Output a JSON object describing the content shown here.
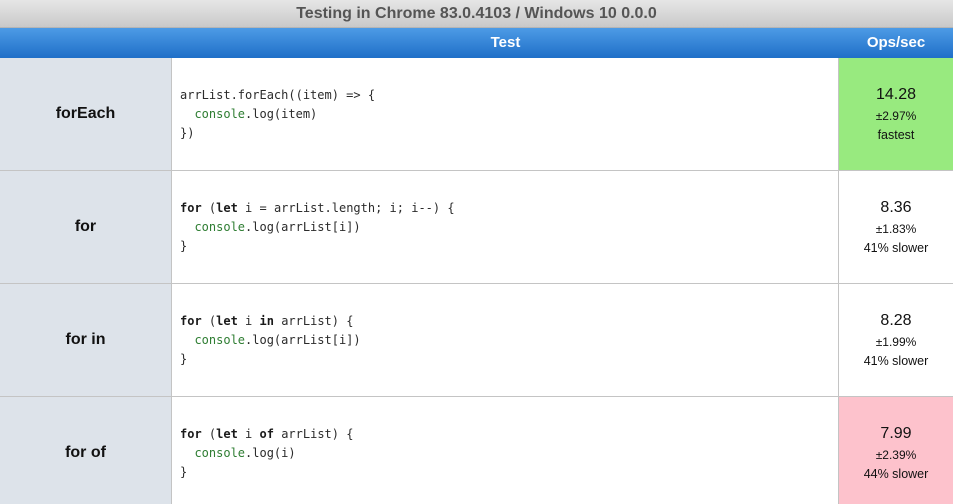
{
  "caption": "Testing in Chrome 83.0.4103 / Windows 10 0.0.0",
  "header": {
    "test_label": "Test",
    "ops_label": "Ops/sec"
  },
  "colors": {
    "fastest": "#98ea7f",
    "slowest": "#fdc2cc",
    "header_blue": "#2e7fd6"
  },
  "rows": [
    {
      "name": "forEach",
      "code": [
        [
          {
            "t": "arrList.forEach((item) => {",
            "c": "default"
          }
        ],
        [
          {
            "t": "  ",
            "c": "default"
          },
          {
            "t": "console",
            "c": "console"
          },
          {
            "t": ".log(item)",
            "c": "default"
          }
        ],
        [
          {
            "t": "})",
            "c": "default"
          }
        ]
      ],
      "ops": "14.28",
      "err": "±2.97%",
      "rank": "fastest",
      "status": "fastest"
    },
    {
      "name": "for",
      "code": [
        [
          {
            "t": "for",
            "c": "kw"
          },
          {
            "t": " (",
            "c": "default"
          },
          {
            "t": "let",
            "c": "kw"
          },
          {
            "t": " i = arrList.length; i; i--) {",
            "c": "default"
          }
        ],
        [
          {
            "t": "  ",
            "c": "default"
          },
          {
            "t": "console",
            "c": "console"
          },
          {
            "t": ".log(arrList[i])",
            "c": "default"
          }
        ],
        [
          {
            "t": "}",
            "c": "default"
          }
        ]
      ],
      "ops": "8.36",
      "err": "±1.83%",
      "rank": "41% slower",
      "status": "normal"
    },
    {
      "name": "for in",
      "code": [
        [
          {
            "t": "for",
            "c": "kw"
          },
          {
            "t": " (",
            "c": "default"
          },
          {
            "t": "let",
            "c": "kw"
          },
          {
            "t": " i ",
            "c": "default"
          },
          {
            "t": "in",
            "c": "kw"
          },
          {
            "t": " arrList) {",
            "c": "default"
          }
        ],
        [
          {
            "t": "  ",
            "c": "default"
          },
          {
            "t": "console",
            "c": "console"
          },
          {
            "t": ".log(arrList[i])",
            "c": "default"
          }
        ],
        [
          {
            "t": "}",
            "c": "default"
          }
        ]
      ],
      "ops": "8.28",
      "err": "±1.99%",
      "rank": "41% slower",
      "status": "normal"
    },
    {
      "name": "for of",
      "code": [
        [
          {
            "t": "for",
            "c": "kw"
          },
          {
            "t": " (",
            "c": "default"
          },
          {
            "t": "let",
            "c": "kw"
          },
          {
            "t": " i ",
            "c": "default"
          },
          {
            "t": "of",
            "c": "kw"
          },
          {
            "t": " arrList) {",
            "c": "default"
          }
        ],
        [
          {
            "t": "  ",
            "c": "default"
          },
          {
            "t": "console",
            "c": "console"
          },
          {
            "t": ".log(i)",
            "c": "default"
          }
        ],
        [
          {
            "t": "}",
            "c": "default"
          }
        ]
      ],
      "ops": "7.99",
      "err": "±2.39%",
      "rank": "44% slower",
      "status": "slowest"
    }
  ]
}
